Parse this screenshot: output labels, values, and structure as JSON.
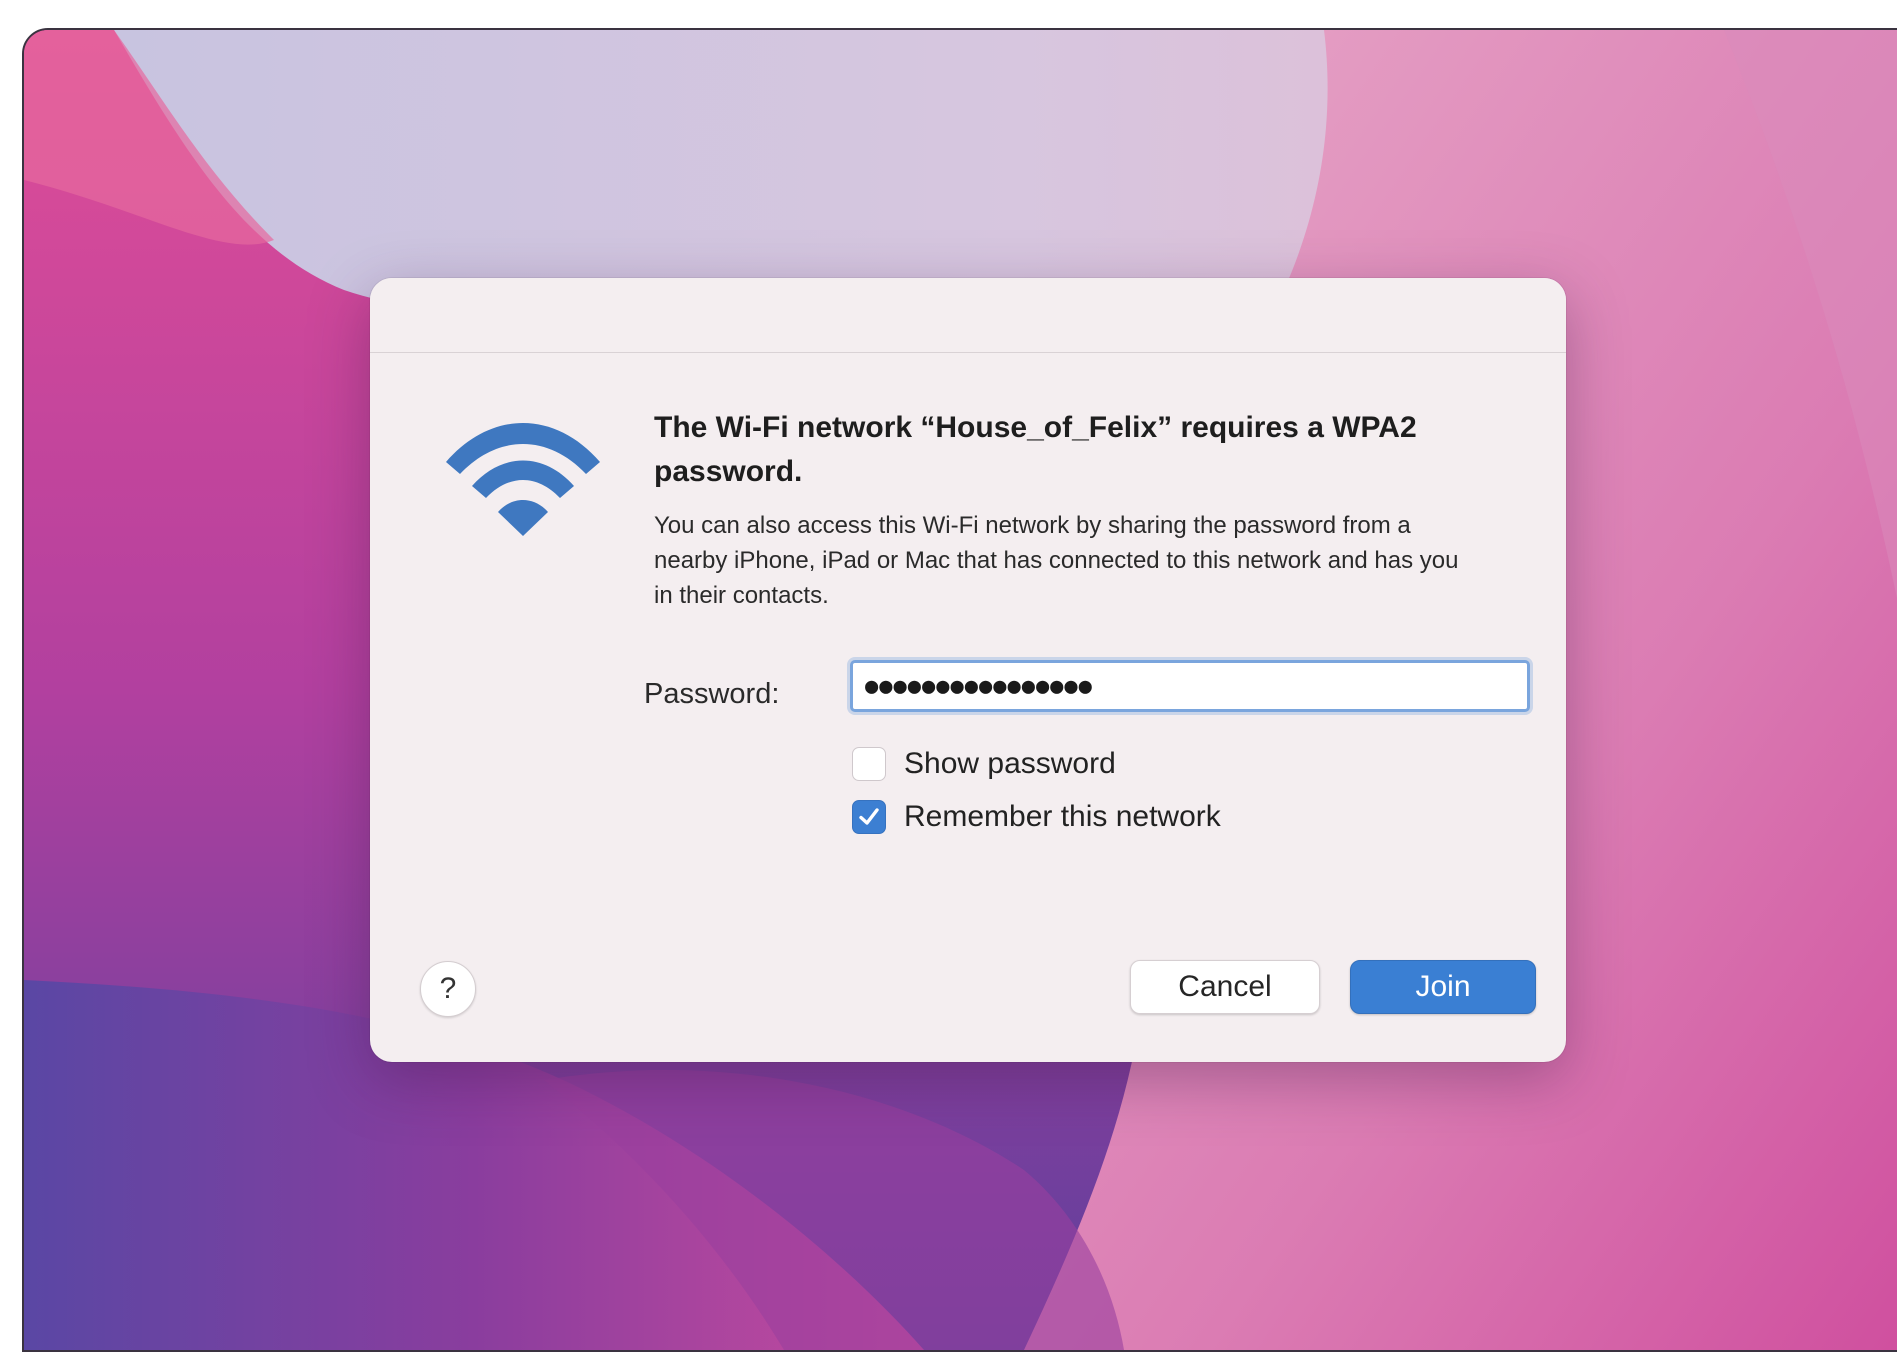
{
  "dialog": {
    "heading": "The Wi-Fi network “House_of_Felix” requires a WPA2 password.",
    "description": "You can also access this Wi-Fi network by sharing the password from a nearby iPhone, iPad or Mac that has connected to this network and has you in their contacts.",
    "password_label": "Password:",
    "password_value": "●●●●●●●●●●●●●●●●",
    "show_password": {
      "label": "Show password",
      "checked": false
    },
    "remember_network": {
      "label": "Remember this network",
      "checked": true
    },
    "help_label": "?",
    "cancel_label": "Cancel",
    "join_label": "Join"
  },
  "icons": {
    "wifi": "wifi-icon",
    "checkmark": "checkmark-icon"
  },
  "colors": {
    "accent": "#3a7fd3",
    "wifi_icon": "#3f78c0",
    "dialog_bg": "#f4eef0"
  }
}
